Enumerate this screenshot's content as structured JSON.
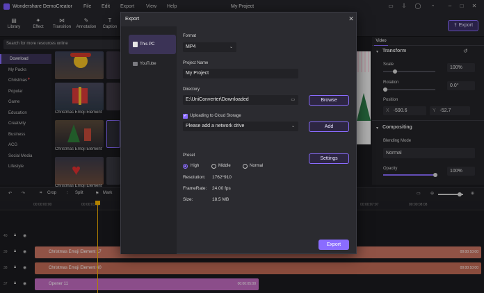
{
  "window": {
    "app_name": "Wondershare DemoCreator",
    "menu": [
      "File",
      "Edit",
      "Export",
      "View",
      "Help"
    ],
    "document_title": "My Project"
  },
  "toolbar": {
    "tools": [
      {
        "label": "Library",
        "icon": "library-icon"
      },
      {
        "label": "Effect",
        "icon": "effect-icon"
      },
      {
        "label": "Transition",
        "icon": "transition-icon"
      },
      {
        "label": "Annotation",
        "icon": "annotation-icon"
      },
      {
        "label": "Caption",
        "icon": "caption-icon"
      }
    ],
    "export_label": "Export"
  },
  "library": {
    "search_placeholder": "Search for more resources online",
    "categories": [
      "Download",
      "My Packs",
      "Christmas",
      "Popular",
      "Game",
      "Education",
      "Creativity",
      "Business",
      "ACG",
      "Social Media",
      "Lifestyle"
    ],
    "active_category": "Download",
    "item_label": "Christmas Emoji Element"
  },
  "properties": {
    "tab": "Video",
    "transform": {
      "title": "Transform",
      "scale_label": "Scale",
      "scale_value": "100%",
      "rotation_label": "Rotation",
      "rotation_value": "0.0°",
      "position_label": "Position",
      "x_label": "X",
      "x_value": "-590.6",
      "y_label": "Y",
      "y_value": "-52.7"
    },
    "compositing": {
      "title": "Compositing",
      "blending_label": "Blending Mode",
      "blending_value": "Normal",
      "opacity_label": "Opacity",
      "opacity_value": "100%"
    }
  },
  "timeline": {
    "tools": [
      "Crop",
      "Split",
      "Mark"
    ],
    "ruler": [
      "00:00:00:00",
      "00:00:01:00",
      "00:00:07:07",
      "00:00:08:08"
    ],
    "tracks": [
      {
        "num": "40",
        "clip": "",
        "end": ""
      },
      {
        "num": "39",
        "clip": "Christmas Emoji Element 17",
        "end": "00:00:10:00"
      },
      {
        "num": "38",
        "clip": "Christmas Emoji Element 60",
        "end": "00:00:10:00"
      },
      {
        "num": "37",
        "clip": "Opener 11",
        "end": "00:00:05:00"
      }
    ]
  },
  "dialog": {
    "title": "Export",
    "nav": [
      {
        "label": "This PC",
        "active": true
      },
      {
        "label": "YouTube",
        "active": false
      }
    ],
    "format_label": "Format",
    "format_value": "MP4",
    "project_name_label": "Project Name",
    "project_name_value": "My Project",
    "directory_label": "Directory",
    "directory_value": "E:\\UniConverter\\Downloaded",
    "browse_label": "Browse",
    "cloud_label": "Uploading to Cloud Storage",
    "cloud_checked": true,
    "drive_placeholder": "Please add a network drive",
    "add_label": "Add",
    "preset_label": "Preset",
    "preset_options": [
      "High",
      "Middle",
      "Normal"
    ],
    "preset_selected": "High",
    "settings_label": "Settings",
    "resolution_label": "Resolution:",
    "resolution_value": "1762*910",
    "framerate_label": "FrameRate:",
    "framerate_value": "24.00 fps",
    "size_label": "Size:",
    "size_value": "18.5 MB",
    "export_label": "Export"
  },
  "colors": {
    "accent": "#8a6cff",
    "clip_orange": "#c97462",
    "clip_pink": "#c16bbf",
    "playhead": "#f5b300"
  }
}
